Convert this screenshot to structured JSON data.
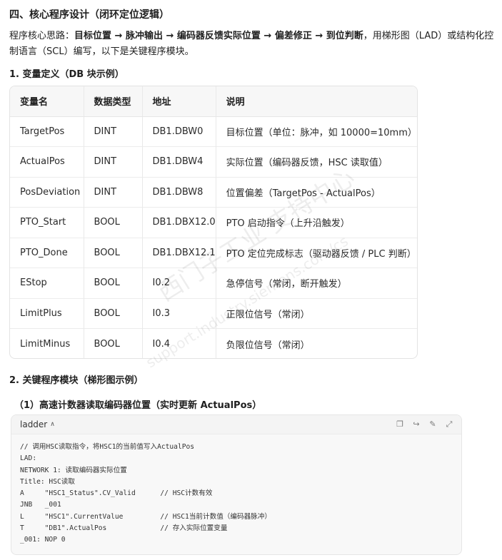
{
  "section": {
    "title": "四、核心程序设计（闭环定位逻辑）"
  },
  "intro": {
    "prefix": "程序核心思路：",
    "bold": "目标位置 → 脉冲输出 → 编码器反馈实际位置 → 偏差修正 → 到位判断",
    "suffix": "，用梯形图（LAD）或结构化控制语言（SCL）编写，以下是关键程序模块。"
  },
  "var_section": {
    "title": "1. 变量定义（DB 块示例）"
  },
  "table": {
    "headers": [
      "变量名",
      "数据类型",
      "地址",
      "说明"
    ],
    "rows": [
      [
        "TargetPos",
        "DINT",
        "DB1.DBW0",
        "目标位置（单位：脉冲，如 10000=10mm）"
      ],
      [
        "ActualPos",
        "DINT",
        "DB1.DBW4",
        "实际位置（编码器反馈，HSC 读取值）"
      ],
      [
        "PosDeviation",
        "DINT",
        "DB1.DBW8",
        "位置偏差（TargetPos - ActualPos）"
      ],
      [
        "PTO_Start",
        "BOOL",
        "DB1.DBX12.0",
        "PTO 启动指令（上升沿触发）"
      ],
      [
        "PTO_Done",
        "BOOL",
        "DB1.DBX12.1",
        "PTO 定位完成标志（驱动器反馈 / PLC 判断）"
      ],
      [
        "EStop",
        "BOOL",
        "I0.2",
        "急停信号（常闭，断开触发）"
      ],
      [
        "LimitPlus",
        "BOOL",
        "I0.3",
        "正限位信号（常闭）"
      ],
      [
        "LimitMinus",
        "BOOL",
        "I0.4",
        "负限位信号（常闭）"
      ]
    ]
  },
  "module_section": {
    "title": "2. 关键程序模块（梯形图示例）"
  },
  "sub_section": {
    "title": "（1）高速计数器读取编码器位置（实时更新 ActualPos）"
  },
  "code": {
    "language": "ladder",
    "lines": [
      "// 调用HSC读取指令，将HSC1的当前值写入ActualPos",
      "LAD:",
      "NETWORK 1: 读取编码器实际位置",
      "Title: HSC读取",
      "A     \"HSC1_Status\".CV_Valid      // HSC计数有效",
      "JNB   _001",
      "L     \"HSC1\".CurrentValue         // HSC1当前计数值（编码器脉冲）",
      "T     \"DB1\".ActualPos             // 存入实际位置变量",
      "_001: NOP 0"
    ]
  },
  "watermark": {
    "cn": "西门子工业 支持中心",
    "en": "support.industry.siemens.com/cs"
  }
}
